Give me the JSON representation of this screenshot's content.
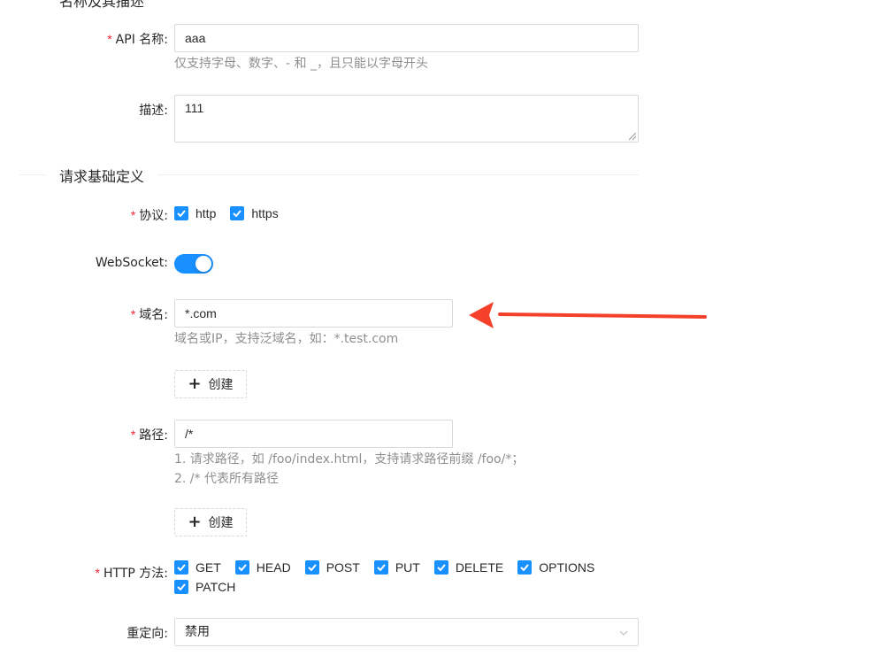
{
  "section_basic": {
    "title": "名称及其描述"
  },
  "api_name": {
    "label": "API 名称",
    "required_mark": "*",
    "value": "aaa",
    "help": "仅支持字母、数字、- 和 _，且只能以字母开头"
  },
  "description": {
    "label": "描述",
    "value": "111"
  },
  "section_request": {
    "title": "请求基础定义"
  },
  "protocol": {
    "label": "协议",
    "required_mark": "*",
    "options": [
      {
        "label": "http",
        "checked": true
      },
      {
        "label": "https",
        "checked": true
      }
    ]
  },
  "websocket": {
    "label": "WebSocket",
    "enabled": true
  },
  "domain": {
    "label": "域名",
    "required_mark": "*",
    "value": "*.com",
    "help": "域名或IP，支持泛域名，如：*.test.com",
    "create_label": "创建"
  },
  "path": {
    "label": "路径",
    "required_mark": "*",
    "value": "/*",
    "help_line1": "1. 请求路径，如 /foo/index.html，支持请求路径前缀 /foo/*；",
    "help_line2": "2. /* 代表所有路径",
    "create_label": "创建"
  },
  "http_methods": {
    "label": "HTTP 方法",
    "required_mark": "*",
    "options": [
      {
        "label": "GET",
        "checked": true
      },
      {
        "label": "HEAD",
        "checked": true
      },
      {
        "label": "POST",
        "checked": true
      },
      {
        "label": "PUT",
        "checked": true
      },
      {
        "label": "DELETE",
        "checked": true
      },
      {
        "label": "OPTIONS",
        "checked": true
      },
      {
        "label": "PATCH",
        "checked": true
      }
    ]
  },
  "redirect": {
    "label": "重定向",
    "value": "禁用"
  },
  "colors": {
    "primary": "#1890ff",
    "required": "#f5222d",
    "annotation_arrow": "#f5412b"
  }
}
